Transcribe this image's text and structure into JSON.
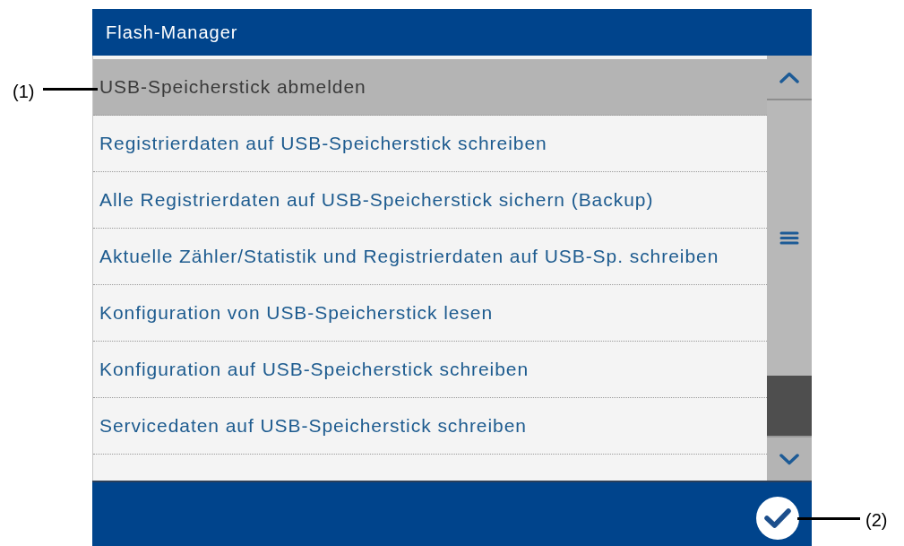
{
  "window": {
    "title": "Flash-Manager"
  },
  "menu": {
    "items": [
      {
        "label": "USB-Speicherstick abmelden",
        "selected": true
      },
      {
        "label": "Registrierdaten auf USB-Speicherstick schreiben",
        "selected": false
      },
      {
        "label": "Alle Registrierdaten auf USB-Speicherstick sichern (Backup)",
        "selected": false
      },
      {
        "label": "Aktuelle Zähler/Statistik und Registrierdaten auf USB-Sp. schreiben",
        "selected": false
      },
      {
        "label": "Konfiguration von USB-Speicherstick lesen",
        "selected": false
      },
      {
        "label": "Konfiguration auf USB-Speicherstick schreiben",
        "selected": false
      },
      {
        "label": "Servicedaten auf USB-Speicherstick schreiben",
        "selected": false
      }
    ]
  },
  "callouts": [
    {
      "label": "(1)"
    },
    {
      "label": "(2)"
    }
  ]
}
